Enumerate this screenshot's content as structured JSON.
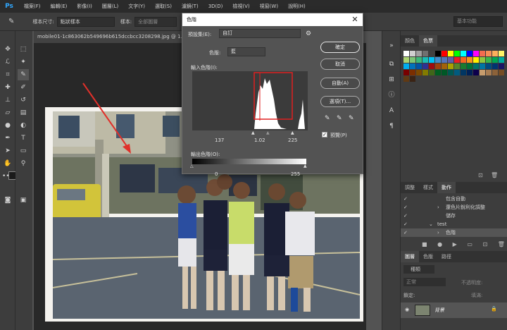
{
  "menubar": {
    "logo": "Ps",
    "items": [
      "檔案(F)",
      "編輯(E)",
      "影像(I)",
      "圖層(L)",
      "文字(Y)",
      "選取(S)",
      "濾鏡(T)",
      "3D(D)",
      "檢視(V)",
      "視窗(W)",
      "說明(H)"
    ]
  },
  "options": {
    "sample_size_label": "樣本尺寸:",
    "sample_size_value": "點狀樣本",
    "sample_label": "樣本:",
    "sample_value": "全部圖層",
    "workspace": "基本功能"
  },
  "document": {
    "tab_title": "mobile01-1c863062b549696b615dccbcc3208298.jpg @ 1..."
  },
  "dialog": {
    "title": "色階",
    "preset_label": "預設集(E):",
    "preset_value": "自訂",
    "channel_label": "色版:",
    "channel_value": "藍",
    "input_levels_label": "輸入色階(I):",
    "input_black": "137",
    "input_gamma": "1.02",
    "input_white": "225",
    "output_levels_label": "輸出色階(O):",
    "output_black": "0",
    "output_white": "255",
    "ok": "確定",
    "cancel": "取消",
    "auto": "自動(A)",
    "options": "選項(T)...",
    "preview_label": "預覽(P)",
    "preview_checked": true,
    "highlight_color": "#e02020"
  },
  "panels": {
    "swatches_tabs": [
      "顏色",
      "色票"
    ],
    "actions_tabs": [
      "調整",
      "樣式",
      "動作"
    ],
    "actions": [
      {
        "label": "包含自動"
      },
      {
        "label": "還色片銳利化調整"
      },
      {
        "label": "儲存"
      },
      {
        "label": "test"
      },
      {
        "label": "色階"
      }
    ],
    "layers_tabs": [
      "圖層",
      "色版",
      "路徑"
    ],
    "layer_kind": "種類",
    "blend_mode": "正常",
    "opacity_label": "不透明度:",
    "lock_label": "鎖定:",
    "fill_label": "填滿:",
    "layer_name": "背景"
  },
  "colors": {
    "accent": "#31a8ff",
    "arrow": "#e0302a"
  }
}
